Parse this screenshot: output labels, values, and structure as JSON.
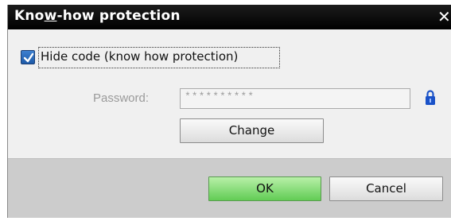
{
  "dialog": {
    "title_prefix": "Kno",
    "title_mnemonic": "w",
    "title_suffix": "-how protection",
    "close_glyph": "✕"
  },
  "hide_code": {
    "label": "Hide code (know how protection)",
    "checked": true
  },
  "password": {
    "label": "Password:",
    "value": "**********",
    "lock_icon": "lock-icon",
    "lock_color": "#1a52c8"
  },
  "buttons": {
    "change": "Change",
    "ok": "OK",
    "cancel": "Cancel"
  },
  "colors": {
    "ok_button": "#62cc55",
    "titlebar": "#000000"
  }
}
